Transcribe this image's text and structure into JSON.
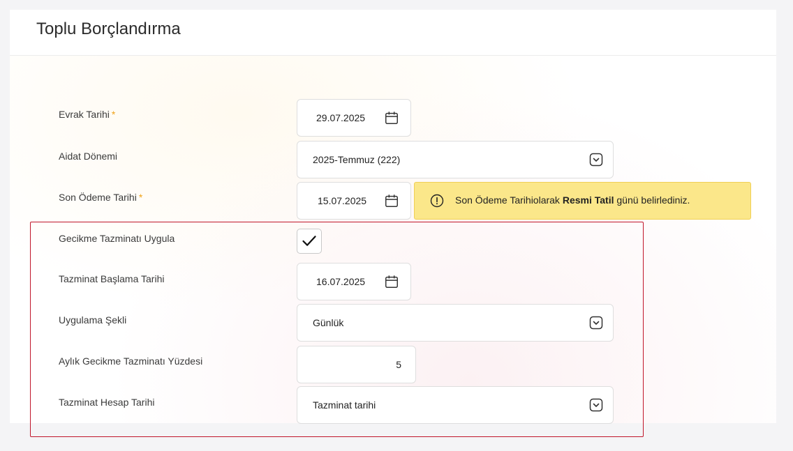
{
  "page": {
    "title": "Toplu Borçlandırma"
  },
  "form": {
    "evrak_tarihi": {
      "label": "Evrak Tarihi",
      "required_mark": "*",
      "value": "29.07.2025"
    },
    "aidat_donemi": {
      "label": "Aidat Dönemi",
      "value": "2025-Temmuz (222)"
    },
    "son_odeme_tarihi": {
      "label": "Son Ödeme Tarihi",
      "required_mark": "*",
      "value": "15.07.2025"
    },
    "warning": {
      "part1": "Son Ödeme Tarihiolarak",
      "bold": "Resmi Tatil",
      "part2": "günü belirlediniz."
    },
    "gecikme_tazminati_uygula": {
      "label": "Gecikme Tazminatı Uygula",
      "checked": true
    },
    "tazminat_baslama_tarihi": {
      "label": "Tazminat Başlama Tarihi",
      "value": "16.07.2025"
    },
    "uygulama_sekli": {
      "label": "Uygulama Şekli",
      "value": "Günlük"
    },
    "aylik_yuzde": {
      "label": "Aylık Gecikme Tazminatı Yüzdesi",
      "value": "5"
    },
    "tazminat_hesap_tarihi": {
      "label": "Tazminat Hesap Tarihi",
      "value": "Tazminat tarihi"
    }
  },
  "colors": {
    "required": "#f0a31a",
    "warning_bg": "#fbe78a",
    "highlight_border": "#c0152a"
  },
  "icons": [
    "calendar-icon",
    "chevron-down-icon",
    "alert-circle-icon",
    "checkmark-icon"
  ]
}
